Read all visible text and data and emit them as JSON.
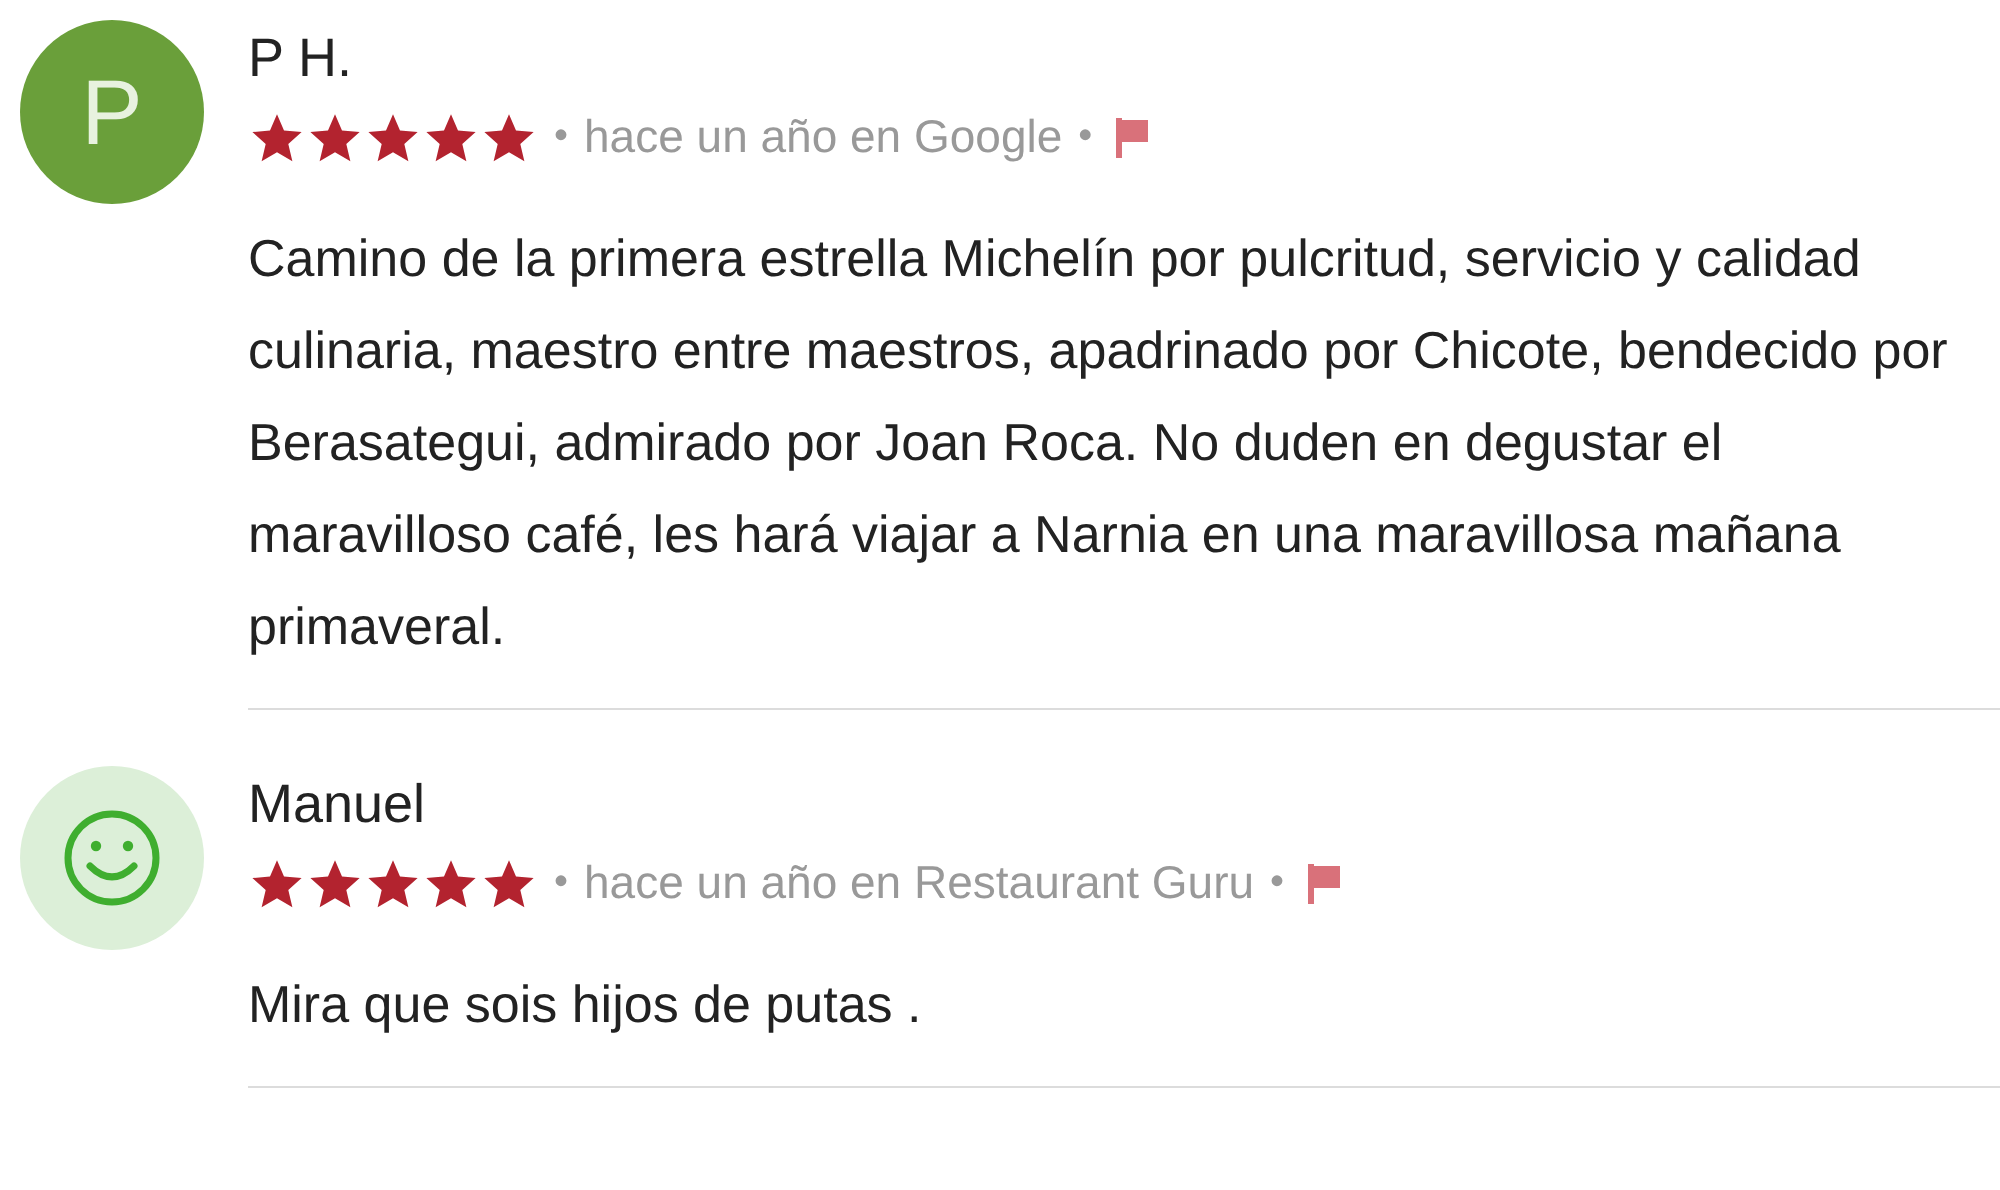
{
  "reviews": [
    {
      "avatar": {
        "kind": "letter",
        "letter": "P",
        "color": "#6a9f3a"
      },
      "name": "P H.",
      "stars": 5,
      "bullets": [
        "•",
        "•"
      ],
      "meta": "hace un año en Google",
      "text": "Camino de la primera estrella Michelín por pulcritud, servicio y calidad culinaria, maestro entre maestros, apadrinado por Chicote, bendecido por Berasategui, admirado por Joan Roca. No duden en degustar el maravilloso café, les hará viajar a Narnia en una maravillosa mañana primaveral."
    },
    {
      "avatar": {
        "kind": "smiley",
        "color": "#dcefd8"
      },
      "name": "Manuel",
      "stars": 5,
      "bullets": [
        "•",
        "•"
      ],
      "meta": "hace un año en Restaurant Guru",
      "text": "Mira que sois hijos de putas ."
    }
  ]
}
